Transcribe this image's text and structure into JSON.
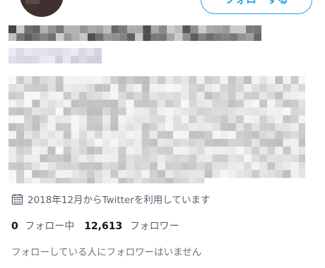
{
  "header": {
    "follow_label": "フォローする"
  },
  "profile": {
    "joined": "2018年12月からTwitterを利用しています",
    "following_count": "0",
    "following_label": "フォロー中",
    "followers_count": "12,613",
    "followers_label": "フォロワー",
    "mutual_note": "フォローしている人にフォロワーはいません"
  },
  "icons": {
    "calendar": "calendar-icon"
  },
  "colors": {
    "accent": "#1da1f2",
    "secondary_text": "#5a6470"
  }
}
